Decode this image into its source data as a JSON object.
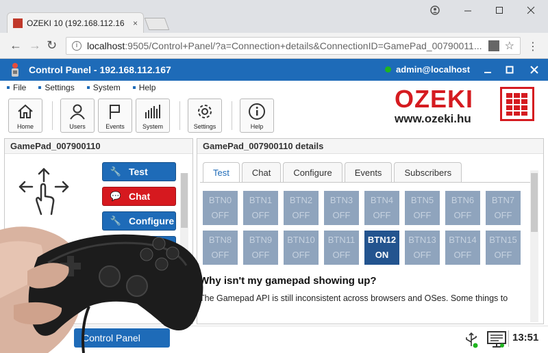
{
  "browser": {
    "tab_title": "OZEKI 10 (192.168.112.16",
    "tab_close": "×",
    "url_host": "localhost",
    "url_rest": ":9505/Control+Panel/?a=Connection+details&ConnectionID=GamePad_00790011...",
    "window_controls": [
      "minimize-icon",
      "maximize-icon",
      "close-icon"
    ]
  },
  "app": {
    "title": "Control Panel - 192.168.112.167",
    "user": "admin@localhost",
    "menu": [
      "File",
      "Settings",
      "System",
      "Help"
    ],
    "toolbar": [
      "Home",
      "Users",
      "Events",
      "System",
      "Settings",
      "Help"
    ],
    "brand_word": "OZEKI",
    "brand_site": "www.ozeki.hu"
  },
  "left": {
    "title": "GamePad_007900110",
    "buttons": [
      {
        "label": "Test",
        "color": "#1e6bb8"
      },
      {
        "label": "Chat",
        "color": "#d6191f"
      },
      {
        "label": "Configure",
        "color": "#1e6bb8"
      }
    ]
  },
  "right": {
    "title": "GamePad_007900110 details",
    "tabs": [
      "Test",
      "Chat",
      "Configure",
      "Events",
      "Subscribers"
    ],
    "active_tab": "Test",
    "buttons": [
      {
        "name": "BTN0",
        "state": "OFF"
      },
      {
        "name": "BTN1",
        "state": "OFF"
      },
      {
        "name": "BTN2",
        "state": "OFF"
      },
      {
        "name": "BTN3",
        "state": "OFF"
      },
      {
        "name": "BTN4",
        "state": "OFF"
      },
      {
        "name": "BTN5",
        "state": "OFF"
      },
      {
        "name": "BTN6",
        "state": "OFF"
      },
      {
        "name": "BTN7",
        "state": "OFF"
      },
      {
        "name": "BTN8",
        "state": "OFF"
      },
      {
        "name": "BTN9",
        "state": "OFF"
      },
      {
        "name": "BTN10",
        "state": "OFF"
      },
      {
        "name": "BTN11",
        "state": "OFF"
      },
      {
        "name": "BTN12",
        "state": "ON"
      },
      {
        "name": "BTN13",
        "state": "OFF"
      },
      {
        "name": "BTN14",
        "state": "OFF"
      },
      {
        "name": "BTN15",
        "state": "OFF"
      }
    ],
    "help_heading": "Why isn't my gamepad showing up?",
    "help_text": "The Gamepad API is still inconsistent across browsers and OSes. Some things to"
  },
  "taskbar": {
    "control_panel": "Control Panel",
    "clock": "13:51"
  },
  "colors": {
    "accent": "#1e6bb8",
    "brand_red": "#d51b20",
    "btn_off": "#8fa4bd",
    "btn_on": "#23548f",
    "status_online": "#1fb51f"
  }
}
